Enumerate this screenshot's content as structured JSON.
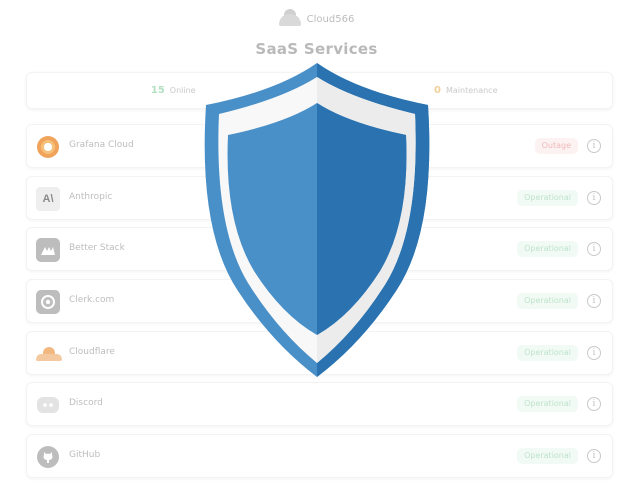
{
  "brand": {
    "name": "Cloud566"
  },
  "page": {
    "title": "SaaS Services"
  },
  "summary": {
    "online": {
      "count": "15",
      "label": "Online",
      "color": "#b5e0c2"
    },
    "maintenance": {
      "count": "0",
      "label": "Maintenance",
      "color": "#f0d19a"
    }
  },
  "services": [
    {
      "name": "Grafana Cloud",
      "status": "Outage",
      "icon": "grafana-icon"
    },
    {
      "name": "Anthropic",
      "status": "Operational",
      "icon": "anthropic-icon"
    },
    {
      "name": "Better Stack",
      "status": "Operational",
      "icon": "better-stack-icon"
    },
    {
      "name": "Clerk.com",
      "status": "Operational",
      "icon": "clerk-icon"
    },
    {
      "name": "Cloudflare",
      "status": "Operational",
      "icon": "cloudflare-icon"
    },
    {
      "name": "Discord",
      "status": "Operational",
      "icon": "discord-icon"
    },
    {
      "name": "GitHub",
      "status": "Operational",
      "icon": "github-icon"
    }
  ],
  "overlay": {
    "icon": "shield-icon",
    "colors": {
      "light": "#4a90c8",
      "dark": "#2a73b0"
    }
  }
}
